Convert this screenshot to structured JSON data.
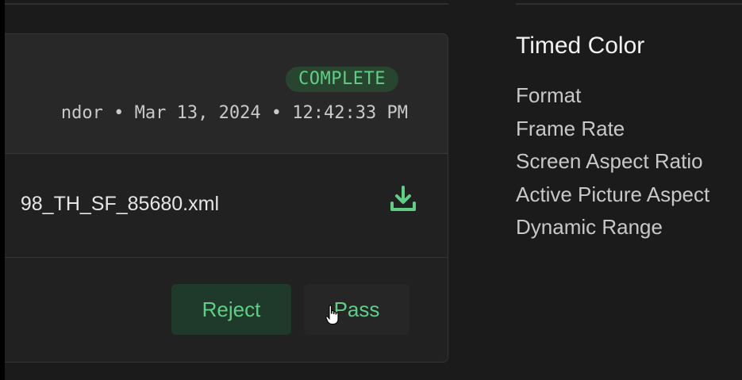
{
  "review_card": {
    "status": "COMPLETE",
    "meta": "ndor • Mar 13, 2024 • 12:42:33 PM",
    "file_name": "98_TH_SF_85680.xml",
    "download_icon": "download-icon",
    "actions": {
      "reject_label": "Reject",
      "pass_label": "Pass"
    }
  },
  "sidebar": {
    "title": "Timed Color",
    "fields": [
      "Format",
      "Frame Rate",
      "Screen Aspect Ratio",
      "Active Picture Aspect",
      "Dynamic Range"
    ]
  },
  "colors": {
    "background": "#1b1b1b",
    "card": "#212121",
    "accent_green": "#5fcf86",
    "badge_bg": "#27452f",
    "reject_bg": "#1f3a2b"
  }
}
